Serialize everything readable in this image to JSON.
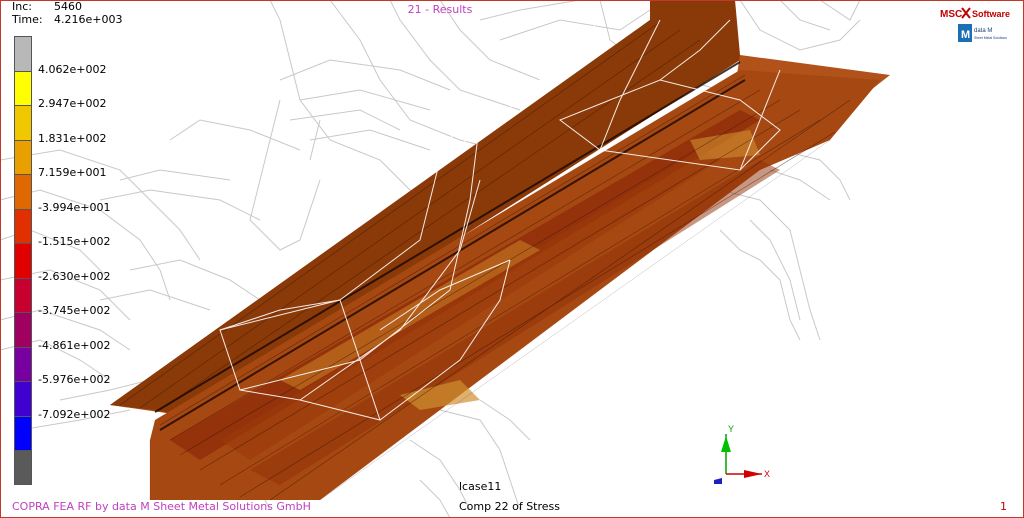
{
  "increment": {
    "label": "Inc:",
    "value": "5460"
  },
  "time": {
    "label": "Time:",
    "value": "4.216e+003"
  },
  "view_title": "21 - Results",
  "legend": {
    "colors": [
      "#b8b8b8",
      "#ffff00",
      "#f0c800",
      "#e8a000",
      "#e06800",
      "#e03000",
      "#e00000",
      "#c80030",
      "#a00060",
      "#7800a0",
      "#4000d0",
      "#0000ff",
      "#5a5a5a"
    ],
    "labels": [
      "4.062e+002",
      "2.947e+002",
      "1.831e+002",
      "7.159e+001",
      "-3.994e+001",
      "-1.515e+002",
      "-2.630e+002",
      "-3.745e+002",
      "-4.861e+002",
      "-5.976e+002",
      "-7.092e+002"
    ]
  },
  "logo": {
    "msc_text": "MSC",
    "software_text": "Software",
    "datam_text": "data M",
    "datam_sub": "Sheet Metal Solutions"
  },
  "triad": {
    "x_label": "X",
    "y_label": "Y"
  },
  "load_case": "lcase11",
  "footer_left": "COPRA FEA RF by data M Sheet Metal Solutions GmbH",
  "footer_center": "Comp 22 of Stress",
  "page_number": "1",
  "colors": {
    "part_fill": "#a84a10",
    "part_edge": "#2a0a00",
    "wire": "#c8c8c8",
    "footer_left": "#c040c0"
  }
}
